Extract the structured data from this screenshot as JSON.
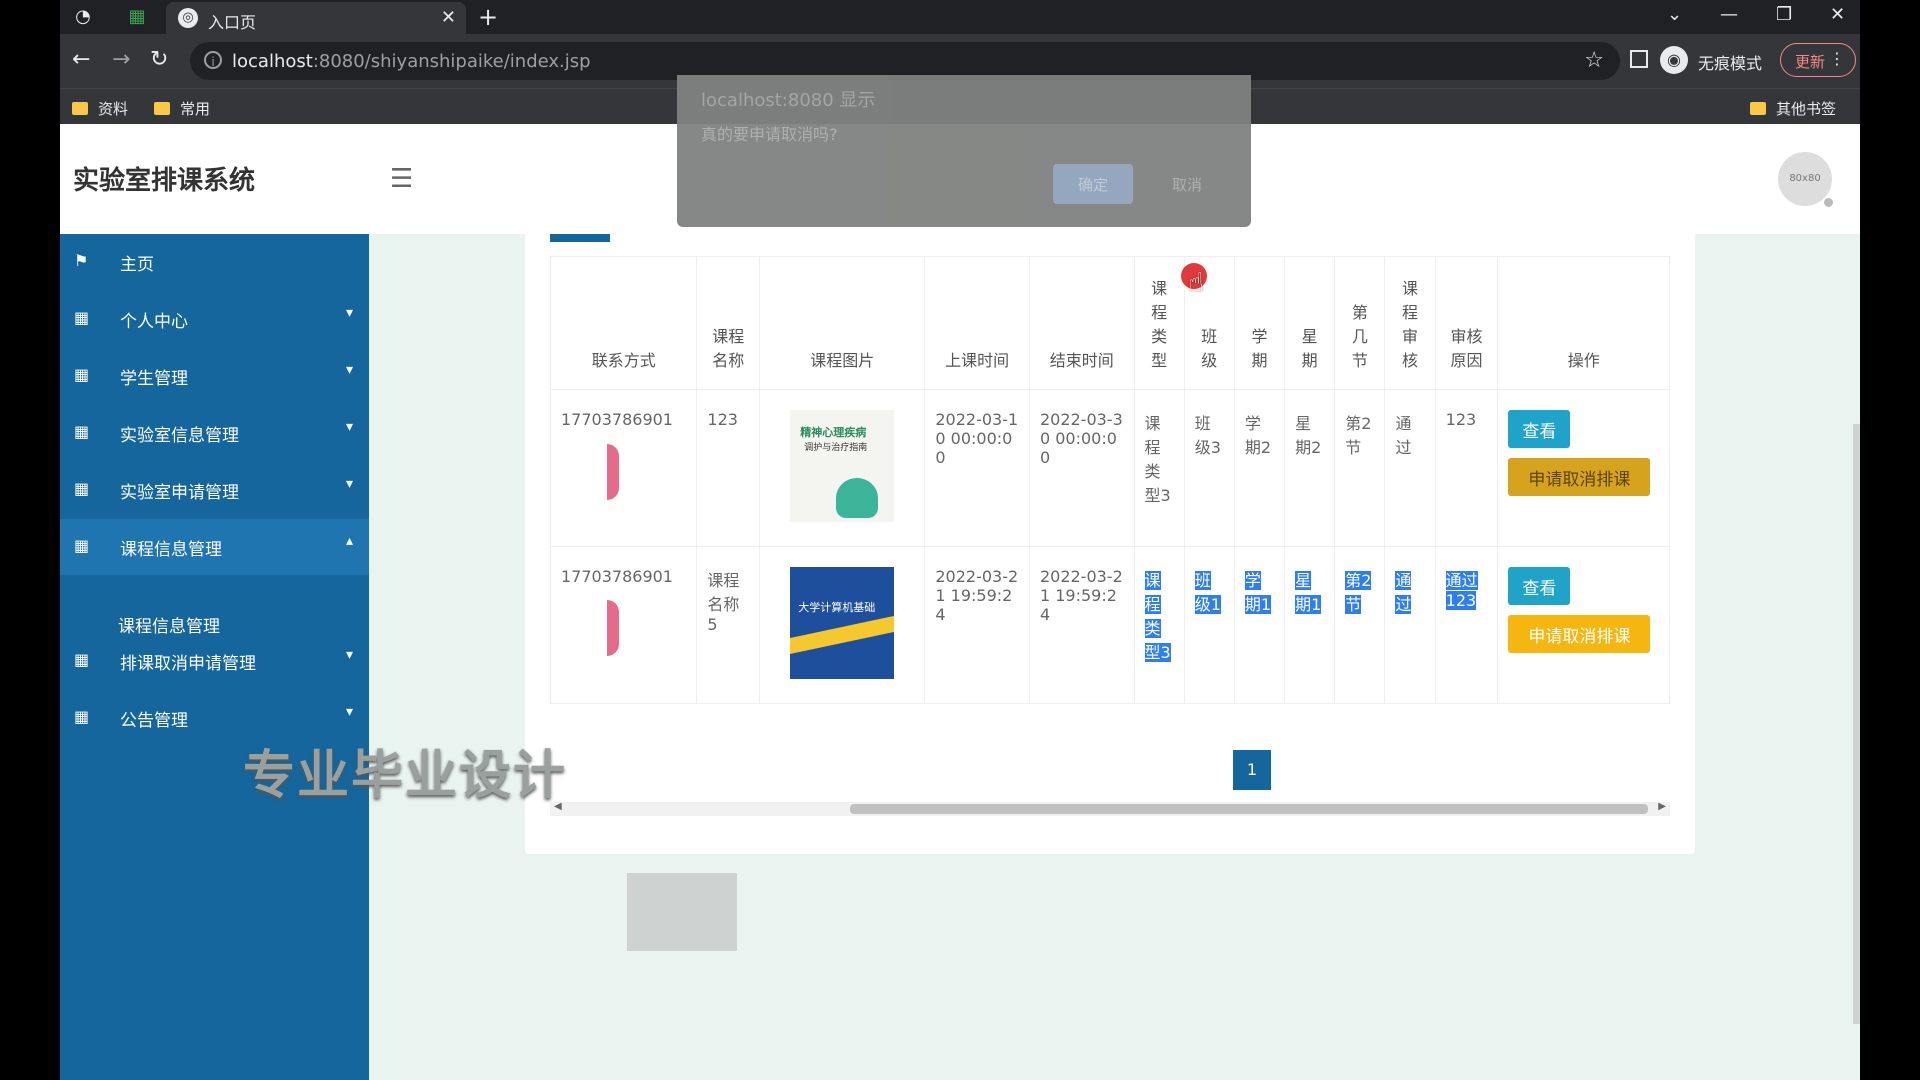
{
  "browser": {
    "tab_title": "入口页",
    "url_host": "localhost",
    "url_rest": ":8080/shiyanshipaike/index.jsp",
    "incognito_label": "无痕模式",
    "update_label": "更新",
    "bookmarks": [
      "资料",
      "常用"
    ],
    "other_bookmarks": "其他书签"
  },
  "app": {
    "title": "实验室排课系统",
    "avatar_text": "80x80"
  },
  "sidebar": {
    "items": [
      {
        "label": "主页"
      },
      {
        "label": "个人中心"
      },
      {
        "label": "学生管理"
      },
      {
        "label": "实验室信息管理"
      },
      {
        "label": "实验室申请管理"
      },
      {
        "label": "课程信息管理"
      },
      {
        "label": "排课取消申请管理"
      },
      {
        "label": "公告管理"
      }
    ],
    "sub_item": "课程信息管理"
  },
  "table": {
    "headers": [
      "联系方式",
      "课程名称",
      "课程图片",
      "上课时间",
      "结束时间",
      "课程类型",
      "班级",
      "学期",
      "星期",
      "第几节",
      "课程审核",
      "审核原因",
      "操作"
    ],
    "rows": [
      {
        "contact": "17703786901",
        "course_name": "123",
        "image_title": "精神心理疾病",
        "image_sub": "调护与治疗指南",
        "start": "2022-03-10 00:00:00",
        "end": "2022-03-30 00:00:00",
        "type": "课程类型3",
        "class": "班级3",
        "term": "学期2",
        "weekday": "星期2",
        "section": "第2节",
        "audit": "通过",
        "reason": "123"
      },
      {
        "contact": "17703786901",
        "course_name": "课程名称5",
        "image_title": "大学计算机基础",
        "start": "2022-03-21 19:59:24",
        "end": "2022-03-21 19:59:24",
        "type": "课程类型3",
        "class": "班级1",
        "term": "学期1",
        "weekday": "星期1",
        "section": "第2节",
        "audit": "通过",
        "reason": "通过123"
      }
    ],
    "view_label": "查看",
    "cancel_label": "申请取消排课"
  },
  "pagination": {
    "current": "1"
  },
  "watermark": "专业毕业设计",
  "dialog": {
    "title": "localhost:8080 显示",
    "message": "真的要申请取消吗?",
    "ok": "确定",
    "cancel": "取消"
  }
}
